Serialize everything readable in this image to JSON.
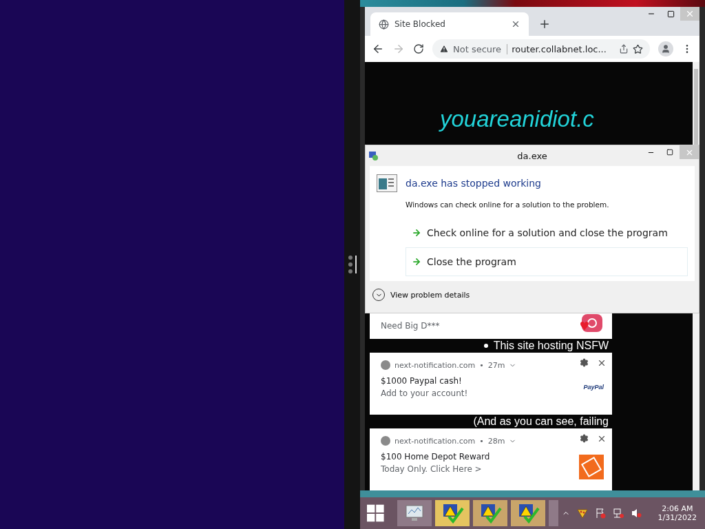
{
  "browser": {
    "tabs": [
      {
        "title": "Site Blocked",
        "selected": true
      }
    ],
    "address_bar": {
      "security": "Not secure",
      "url": "router.collabnet.loc..."
    },
    "page": {
      "heading": "youareanidiot.c",
      "items": [
        {
          "kind": "notification",
          "body": "Need Big D***",
          "logo": {
            "kind": "instagram"
          }
        },
        {
          "kind": "line",
          "text": "This site hosting NSFW",
          "bullet": true
        },
        {
          "kind": "notification",
          "source": "next-notification.com",
          "separator": "•",
          "age": "27m",
          "title": "$1000 Paypal cash!",
          "body": "Add to your account!",
          "logo": {
            "kind": "paypal",
            "text": "PayPal"
          }
        },
        {
          "kind": "line",
          "text": "(And as you can see, failing",
          "bullet": false
        },
        {
          "kind": "notification",
          "source": "next-notification.com",
          "separator": "•",
          "age": "28m",
          "title": "$100 Home Depot Reward",
          "body": "Today Only. Click Here >",
          "logo": {
            "kind": "homedepot"
          }
        }
      ]
    }
  },
  "dialog": {
    "title": "da.exe",
    "heading": "da.exe has stopped working",
    "message": "Windows can check online for a solution to the problem.",
    "options": [
      {
        "label": "Check online for a solution and close the program",
        "selected": false
      },
      {
        "label": "Close the program",
        "selected": true
      }
    ],
    "details": "View problem details"
  },
  "taskbar": {
    "buttons": [
      {
        "kind": "monitor",
        "selected": false
      },
      {
        "kind": "warning",
        "selected": true
      },
      {
        "kind": "warning",
        "selected": false
      },
      {
        "kind": "warning",
        "selected": false
      }
    ],
    "time": "2:06 AM",
    "date": "1/31/2022"
  }
}
